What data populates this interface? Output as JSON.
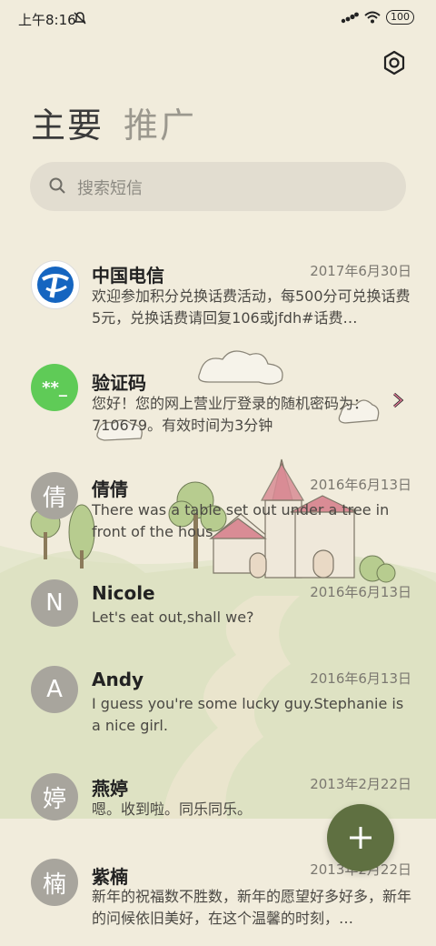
{
  "status": {
    "time": "上午8:16",
    "battery": "100"
  },
  "tabs": [
    {
      "label": "主要"
    },
    {
      "label": "推广"
    }
  ],
  "search": {
    "placeholder": "搜索短信"
  },
  "messages": [
    {
      "name": "中国电信",
      "date": "2017年6月30日",
      "preview": "欢迎参加积分兑换话费活动，每500分可兑换话费5元，兑换话费请回复106或jfdh#话费…",
      "avatar": ""
    },
    {
      "name": "验证码",
      "date": "",
      "preview": "您好！您的网上营业厅登录的随机密码为：710679。有效时间为3分钟",
      "avatar": "**_"
    },
    {
      "name": "倩倩",
      "date": "2016年6月13日",
      "preview": "There was a table set out under a tree in front of the hous",
      "avatar": "倩"
    },
    {
      "name": "Nicole",
      "date": "2016年6月13日",
      "preview": "Let's eat out,shall we?",
      "avatar": "N"
    },
    {
      "name": "Andy",
      "date": "2016年6月13日",
      "preview": "I guess you're some lucky guy.Stephanie is a nice girl.",
      "avatar": "A"
    },
    {
      "name": "燕婷",
      "date": "2013年2月22日",
      "preview": "嗯。收到啦。同乐同乐。",
      "avatar": "婷"
    },
    {
      "name": "紫楠",
      "date": "2013年2月22日",
      "preview": "新年的祝福数不胜数，新年的愿望好多好多，新年的问候依旧美好，在这个温馨的时刻，…",
      "avatar": "楠"
    }
  ],
  "icons": {
    "settings": "gear-icon",
    "search": "search-icon",
    "compose": "plus-icon",
    "mute": "mute-icon",
    "signal": "signal-icon",
    "wifi": "wifi-icon"
  },
  "colors": {
    "background": "#f1ecdc",
    "fab": "#5f7041",
    "verify_avatar": "#5fcb57"
  }
}
